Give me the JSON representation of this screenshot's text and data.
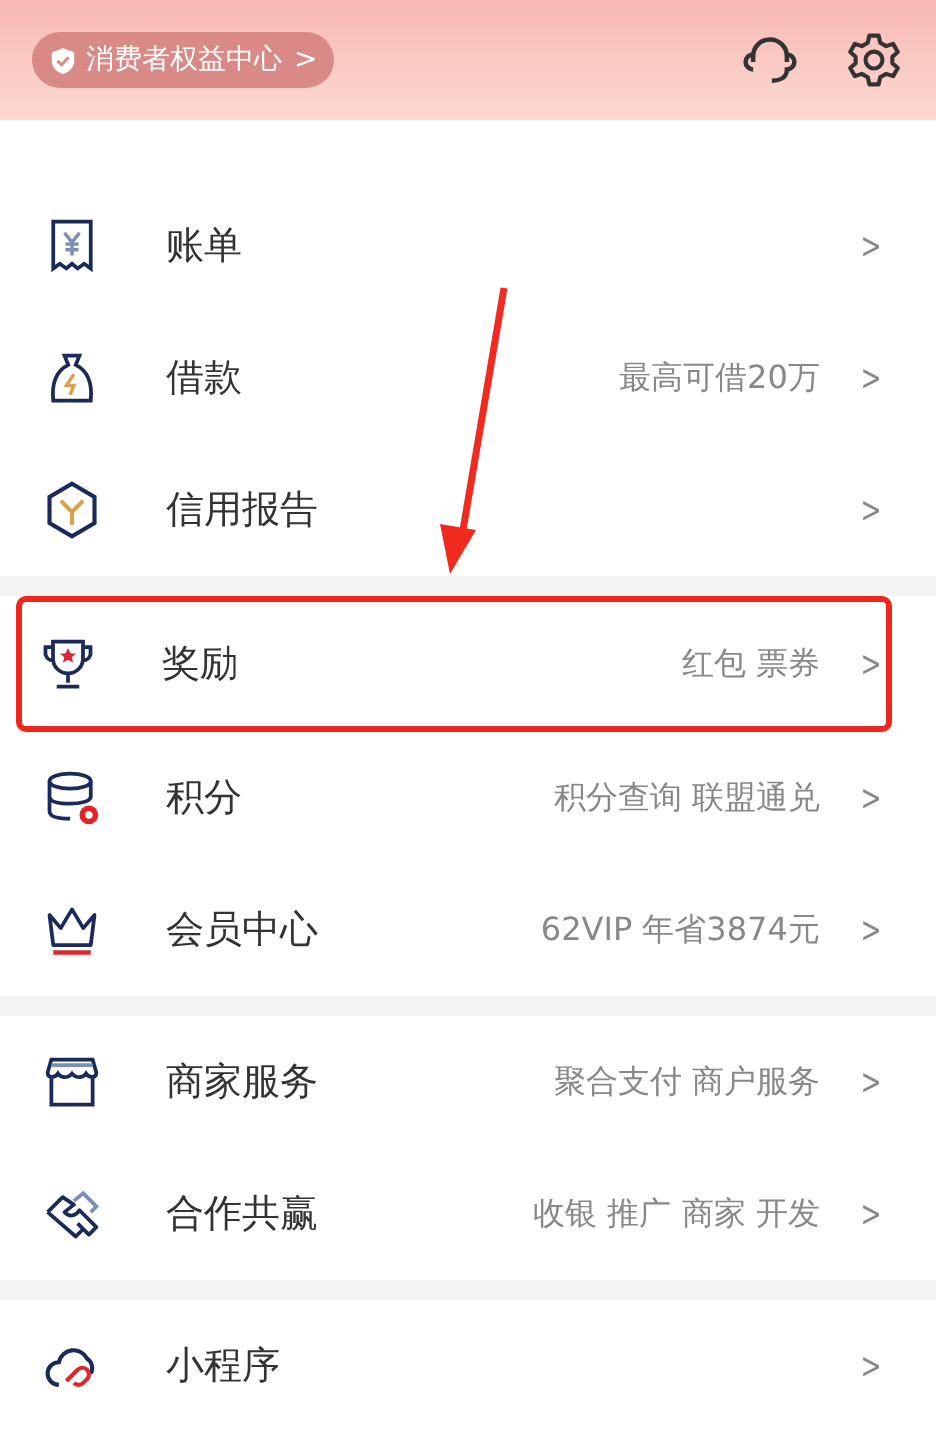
{
  "header": {
    "badge": "消费者权益中心",
    "badge_chevron": ">"
  },
  "sections": [
    {
      "items": [
        {
          "title": "账单",
          "chevron": ">",
          "highlighted": false
        },
        {
          "title": "借款",
          "subtitle": "最高可借20万",
          "chevron": ">",
          "highlighted": false
        },
        {
          "title": "信用报告",
          "chevron": ">",
          "highlighted": false
        }
      ]
    },
    {
      "items": [
        {
          "title": "奖励",
          "subtitle": "红包 票券",
          "chevron": ">",
          "highlighted": true
        },
        {
          "title": "积分",
          "subtitle": "积分查询 联盟通兑",
          "chevron": ">",
          "highlighted": false
        },
        {
          "title": "会员中心",
          "subtitle": "62VIP 年省3874元",
          "chevron": ">",
          "highlighted": false
        }
      ]
    },
    {
      "items": [
        {
          "title": "商家服务",
          "subtitle": "聚合支付 商户服务",
          "chevron": ">",
          "highlighted": false
        },
        {
          "title": "合作共赢",
          "subtitle": "收银 推广 商家 开发",
          "chevron": ">",
          "highlighted": false
        }
      ]
    },
    {
      "items": [
        {
          "title": "小程序",
          "chevron": ">",
          "highlighted": false
        }
      ]
    }
  ]
}
